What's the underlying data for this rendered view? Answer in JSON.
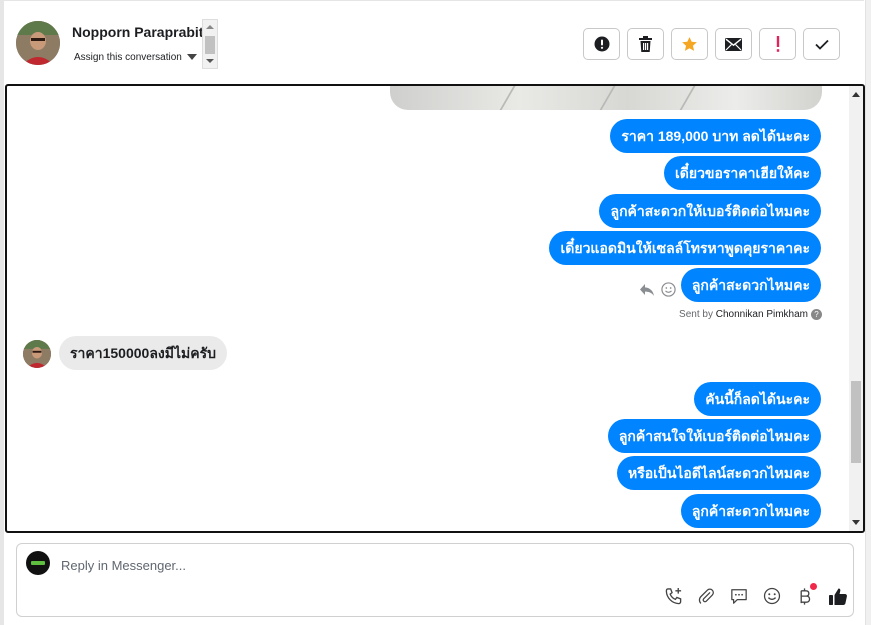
{
  "header": {
    "contact_name": "Nopporn Paraprabit",
    "assign_label": "Assign this conversation",
    "actions": [
      {
        "name": "spam-button",
        "icon": "exclamation-circle-icon"
      },
      {
        "name": "delete-button",
        "icon": "trash-icon"
      },
      {
        "name": "star-button",
        "icon": "star-icon",
        "color": "#f5a623"
      },
      {
        "name": "mark-unread-button",
        "icon": "envelope-icon"
      },
      {
        "name": "follow-up-button",
        "icon": "red-exclamation-icon",
        "color": "#e0245e"
      },
      {
        "name": "mark-done-button",
        "icon": "checkmark-icon"
      }
    ]
  },
  "thread": {
    "outgoing_1": [
      "ราคา 189,000 บาท ลดได้นะคะ",
      "เดี๋ยวขอราคาเฮียให้คะ",
      "ลูกค้าสะดวกให้เบอร์ติดต่อไหมคะ",
      "เดี๋ยวแอดมินให้เซลล์โทรหาพูดคุยราคาคะ",
      "ลูกค้าสะดวกไหมคะ"
    ],
    "sent_by_prefix": "Sent by",
    "sent_by_agent": "Chonnikan Pimkham",
    "help_mark": "?",
    "incoming": "ราคา150000ลงมีไม่ครับ",
    "outgoing_2": [
      "คันนี้ก็ลดได้นะคะ",
      "ลูกค้าสนใจให้เบอร์ติดต่อไหมคะ",
      "หรือเป็นไอดีไลน์สะดวกไหมคะ",
      "ลูกค้าสะดวกไหมคะ"
    ],
    "bubble_color": "#0084ff"
  },
  "composer": {
    "placeholder": "Reply in Messenger...",
    "tools": [
      "phone-plus-icon",
      "paperclip-icon",
      "saved-reply-icon",
      "emoji-icon",
      "baht-payment-icon",
      "thumbs-up-icon"
    ]
  }
}
